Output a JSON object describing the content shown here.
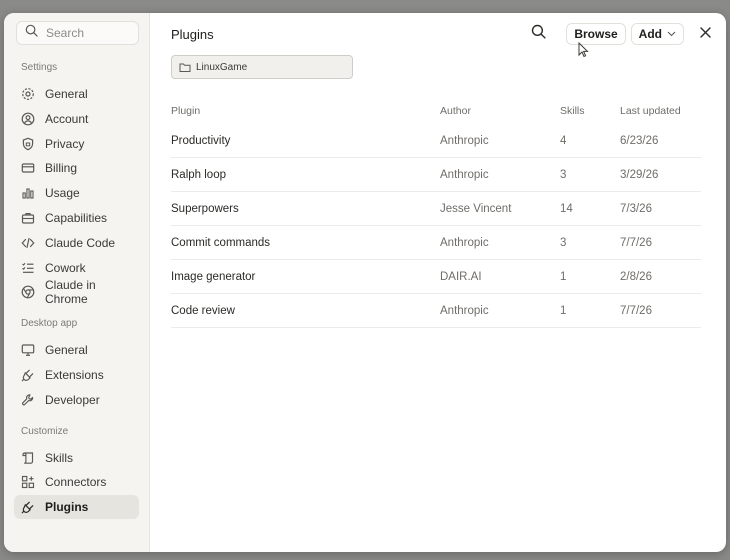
{
  "sidebar": {
    "search_placeholder": "Search",
    "sections": {
      "settings": "Settings",
      "desktop_app": "Desktop app",
      "customize": "Customize"
    },
    "settings_items": [
      "General",
      "Account",
      "Privacy",
      "Billing",
      "Usage",
      "Capabilities",
      "Claude Code",
      "Cowork",
      "Claude in Chrome"
    ],
    "desktop_items": [
      "General",
      "Extensions",
      "Developer"
    ],
    "customize_items": [
      "Skills",
      "Connectors",
      "Plugins"
    ]
  },
  "main": {
    "title": "Plugins",
    "folder_label": "LinuxGame",
    "browse_label": "Browse",
    "add_label": "Add"
  },
  "table": {
    "headers": [
      "Plugin",
      "Author",
      "Skills",
      "Last updated"
    ],
    "rows": [
      [
        "Productivity",
        "Anthropic",
        "4",
        "6/23/26"
      ],
      [
        "Ralph loop",
        "Anthropic",
        "3",
        "3/29/26"
      ],
      [
        "Superpowers",
        "Jesse Vincent",
        "14",
        "7/3/26"
      ],
      [
        "Commit commands",
        "Anthropic",
        "3",
        "7/7/26"
      ],
      [
        "Image generator",
        "DAIR.AI",
        "1",
        "2/8/26"
      ],
      [
        "Code review",
        "Anthropic",
        "1",
        "7/7/26"
      ]
    ]
  },
  "icons": {
    "search": "search-icon",
    "close": "close-icon",
    "chevron": "chevron-down-icon",
    "folder": "folder-icon"
  },
  "colors": {
    "sidebar_bg": "#f5f4f1",
    "active_item_bg": "#e6e4df",
    "backdrop": "#8a8a88"
  }
}
